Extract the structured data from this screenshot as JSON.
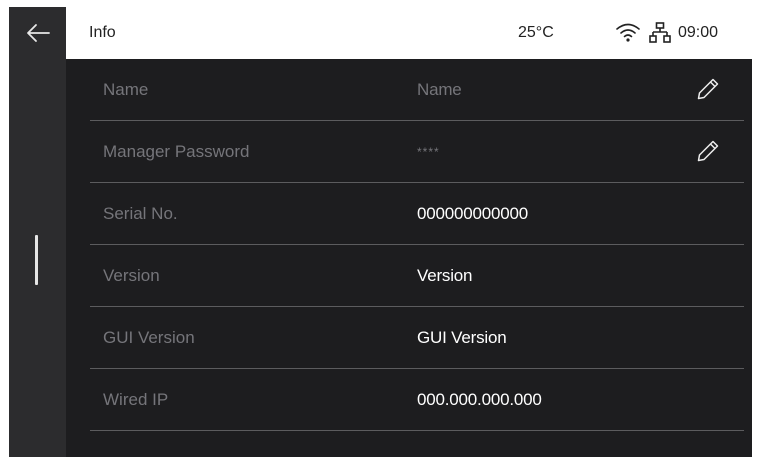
{
  "header": {
    "title": "Info",
    "temperature": "25°C",
    "time": "09:00",
    "icons": [
      "back-arrow-icon",
      "wifi-icon",
      "network-icon"
    ]
  },
  "rows": [
    {
      "label": "Name",
      "value": "Name",
      "editable": true,
      "icon": "pencil-icon"
    },
    {
      "label": "Manager Password",
      "value": "****",
      "editable": true,
      "icon": "pencil-icon"
    },
    {
      "label": "Serial No.",
      "value": "000000000000",
      "editable": false
    },
    {
      "label": "Version",
      "value": "Version",
      "editable": false
    },
    {
      "label": "GUI Version",
      "value": "GUI Version",
      "editable": false
    },
    {
      "label": "Wired IP",
      "value": "000.000.000.000",
      "editable": false
    }
  ],
  "colors": {
    "background": "#1d1d1f",
    "rail": "#2c2c2e",
    "header": "#ffffff",
    "label": "#75757a",
    "value": "#ffffff",
    "divider": "#5c5c5e"
  }
}
